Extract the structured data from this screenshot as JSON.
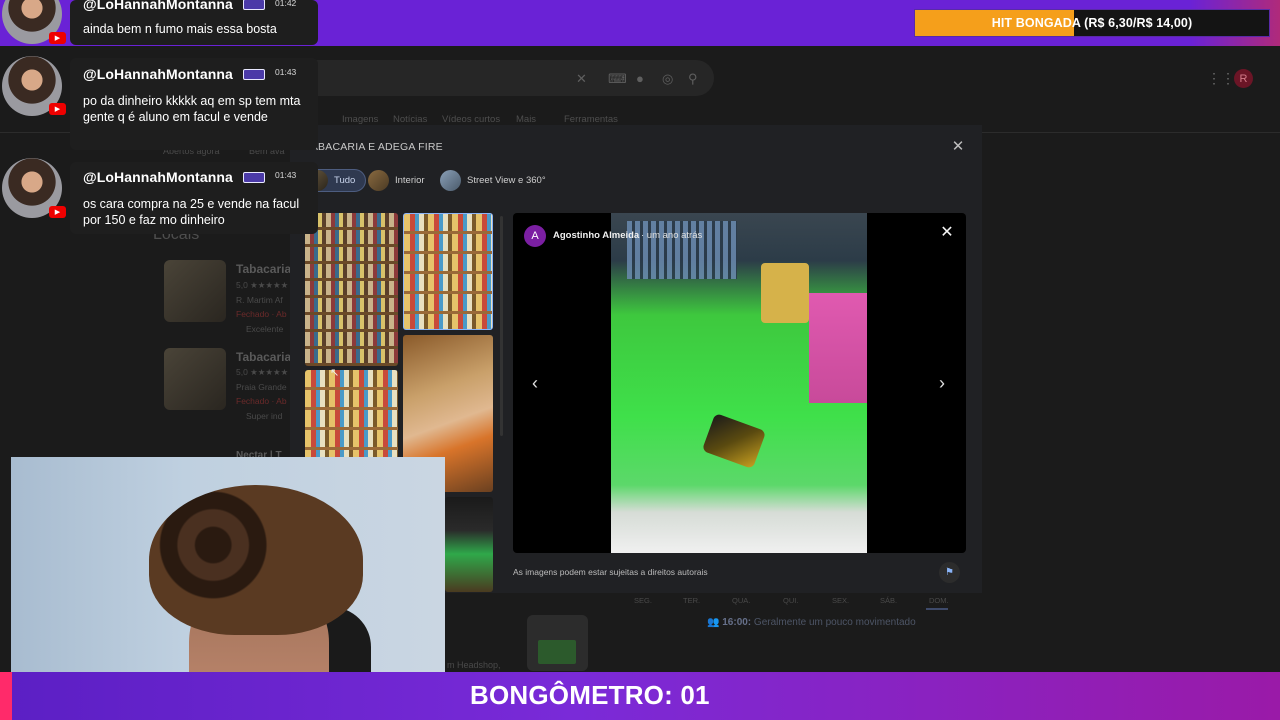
{
  "stream_overlay": {
    "hit_meter": {
      "label": "HIT BONGADA (R$ 6,30/R$ 14,00)",
      "progress": 0.45,
      "fill_color": "#f59f1b"
    },
    "bongometro": "BONGÔMETRO: 01",
    "accent_color": "#6a22d6"
  },
  "chat": [
    {
      "user": "@LoHannahMontanna",
      "time": "01:42",
      "message": "ainda bem n fumo mais essa bosta"
    },
    {
      "user": "@LoHannahMontanna",
      "time": "01:43",
      "message": "po da dinheiro kkkkk aq em sp tem mta gente q é aluno em facul e vende"
    },
    {
      "user": "@LoHannahMontanna",
      "time": "01:43",
      "message": "os cara compra na 25 e vende na facul por 150 e faz mo dinheiro"
    }
  ],
  "google": {
    "tabs": [
      "Imagens",
      "Notícias",
      "Vídeos curtos",
      "Mais",
      "Ferramentas"
    ],
    "filters": [
      "Abertos agora",
      "Bem ava"
    ],
    "section_title": "Locais",
    "places": [
      {
        "name": "Tabacaria",
        "rating": "5,0 ★★★★★",
        "address": "R. Martim Af",
        "status": "Fechado · Ab",
        "note": "Excelente"
      },
      {
        "name": "Tabacaria",
        "rating": "5,0 ★★★★★",
        "address": "Praia Grande",
        "status": "Fechado · Ab",
        "note": "Super ind"
      },
      {
        "name": "Nectar | T",
        "rating": "",
        "address": "",
        "status": "",
        "note": ""
      }
    ],
    "days": [
      "SEG.",
      "TER.",
      "QUA.",
      "QUI.",
      "SEX.",
      "SÁB.",
      "DOM."
    ],
    "busy_time": "16:00:",
    "busy_text": "Geralmente um pouco movimentado",
    "headshop": "m Headshop,",
    "avatar_letter": "R"
  },
  "photo_viewer": {
    "title": "TABACARIA E ADEGA FIRE",
    "chips": [
      "Tudo",
      "Interior",
      "Street View e 360°"
    ],
    "author_initial": "A",
    "author": "Agostinho Almeida",
    "time_ago": "· um ano atrás",
    "copyright": "As imagens podem estar sujeitas a direitos autorais"
  }
}
